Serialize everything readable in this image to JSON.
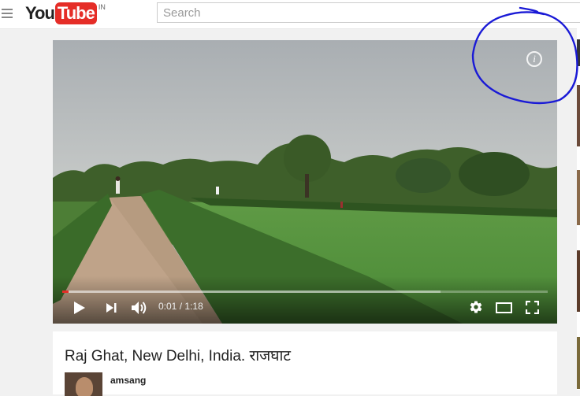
{
  "header": {
    "logo_you": "You",
    "logo_tube": "Tube",
    "country_code": "IN",
    "search_placeholder": "Search"
  },
  "player": {
    "current_time": "0:01",
    "time_separator": "/",
    "duration": "1:18",
    "progress_fraction": 0.013,
    "buffered_fraction": 0.78
  },
  "video": {
    "title": "Raj Ghat, New Delhi, India. राजघाट",
    "channel": "amsang"
  },
  "colors": {
    "brand_red": "#e52d27",
    "annotation_blue": "#1a1ad6"
  }
}
